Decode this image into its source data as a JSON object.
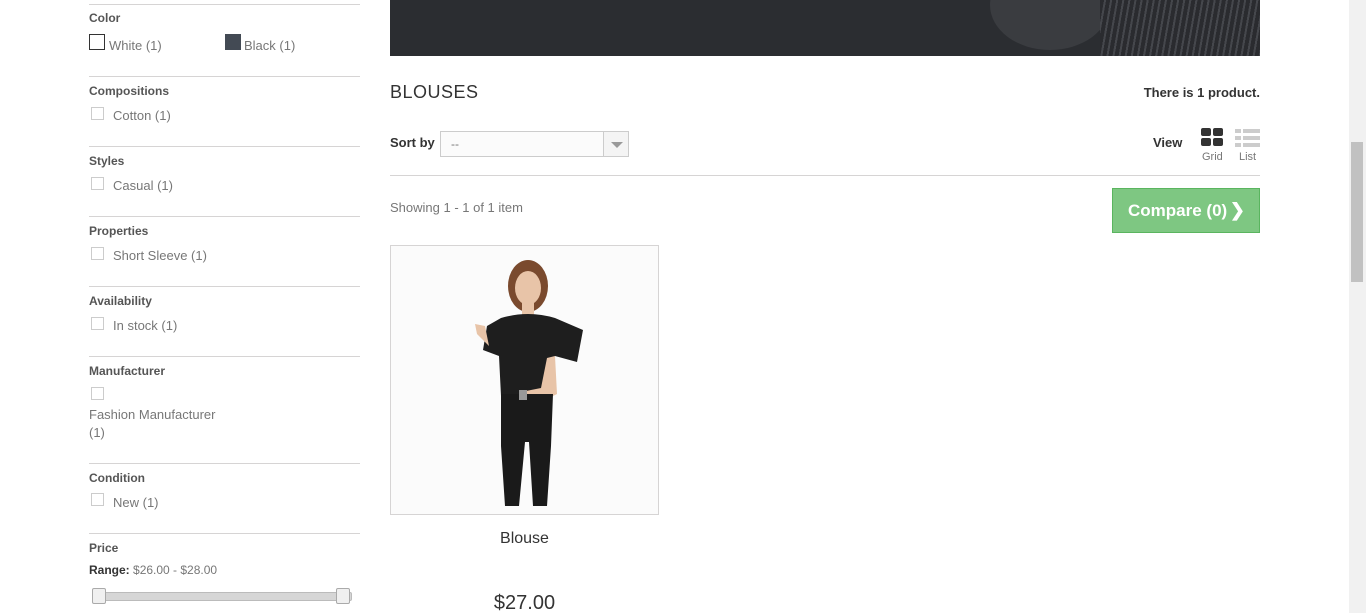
{
  "filters": {
    "color": {
      "title": "Color",
      "options": [
        {
          "label": "White (1)"
        },
        {
          "label": "Black (1)"
        }
      ]
    },
    "compositions": {
      "title": "Compositions",
      "options": [
        {
          "label": "Cotton (1)"
        }
      ]
    },
    "styles": {
      "title": "Styles",
      "options": [
        {
          "label": "Casual (1)"
        }
      ]
    },
    "properties": {
      "title": "Properties",
      "options": [
        {
          "label": "Short Sleeve (1)"
        }
      ]
    },
    "availability": {
      "title": "Availability",
      "options": [
        {
          "label": "In stock (1)"
        }
      ]
    },
    "manufacturer": {
      "title": "Manufacturer",
      "options": [
        {
          "label": "Fashion Manufacturer",
          "count": "(1)"
        }
      ]
    },
    "condition": {
      "title": "Condition",
      "options": [
        {
          "label": "New (1)"
        }
      ]
    },
    "price": {
      "title": "Price",
      "range_label": "Range:",
      "range_value": "$26.00 - $28.00"
    }
  },
  "category": {
    "title": "BLOUSES",
    "product_count": "There is 1 product.",
    "sort_label": "Sort by",
    "sort_value": "--",
    "view_label": "View",
    "view_grid": "Grid",
    "view_list": "List",
    "showing": "Showing 1 - 1 of 1 item",
    "compare_label": "Compare (0)"
  },
  "products": [
    {
      "name": "Blouse",
      "price": "$27.00"
    }
  ],
  "colors": {
    "compare_bg": "#7ec782",
    "swatch_black": "#434a54"
  }
}
